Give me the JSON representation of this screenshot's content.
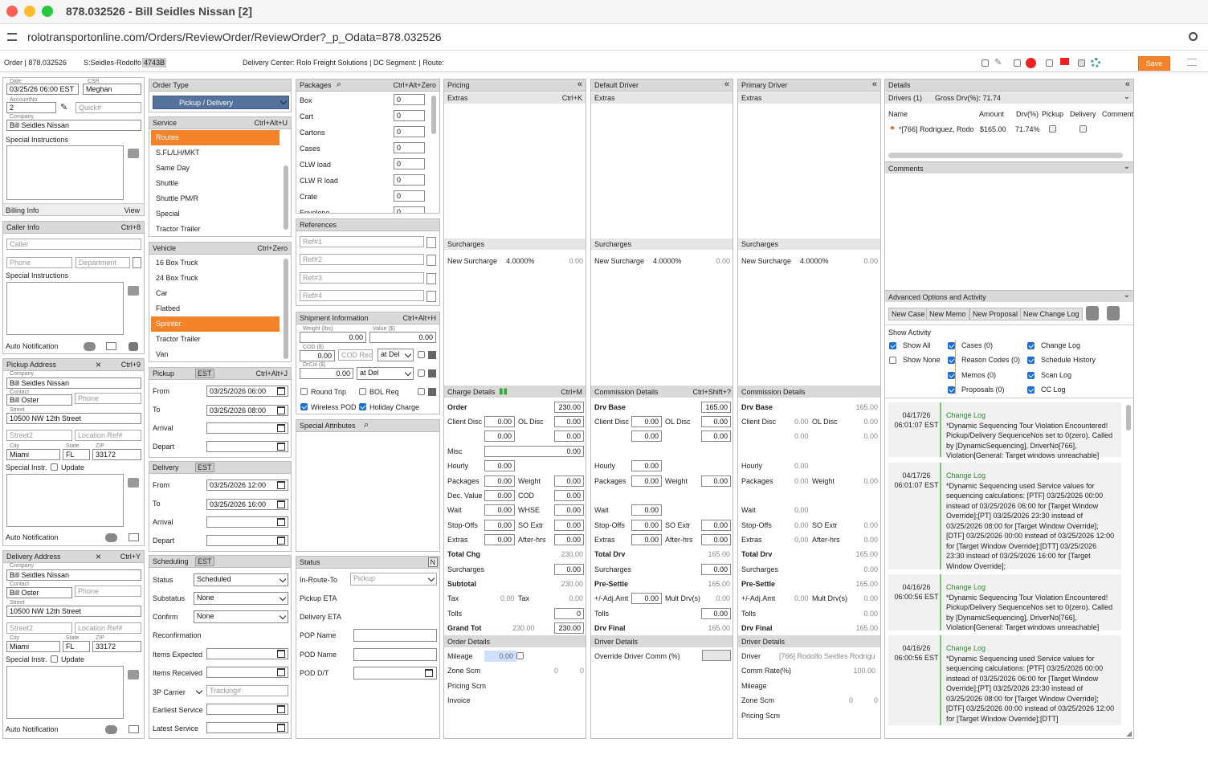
{
  "window": {
    "title": "878.032526 - Bill Seidles Nissan [2]",
    "url": "rolotransportonline.com/Orders/ReviewOrder/ReviewOrder?_p_Odata=878.032526"
  },
  "orderbar": {
    "order": "Order | 878.032526",
    "s": "S:Seidles-Rodolfo",
    "sbadge": "4743B",
    "dc": "Delivery Center: Rolo Freight Solutions | DC Segment: | Route:",
    "save": "Save"
  },
  "left": {
    "date_lbl": "Date",
    "date": "03/25/26 06:00 EST",
    "csr_lbl": "CSR",
    "csr": "Meghan",
    "acct_lbl": "AccountNo",
    "acct": "2",
    "quick": "Quick#",
    "company_lbl": "Company",
    "company": "Bill Seidles Nissan",
    "special": "Special Instructions",
    "billing": "Billing Info",
    "view": "View",
    "caller_h": "Caller Info",
    "caller_k": "Ctrl+8",
    "caller": "Caller",
    "phone": "Phone",
    "dept": "Department",
    "special2": "Special Instructions",
    "autonot": "Auto Notification",
    "pickup_h": "Pickup Address",
    "pickup_k": "Ctrl+9",
    "p_company": "Bill Seidles Nissan",
    "p_contact": "Bill Oster",
    "p_street": "10500 NW 12th Street",
    "street2": "Street2",
    "locref": "Location Ref#",
    "city_lbl": "City",
    "state_lbl": "State",
    "zip_lbl": "ZIP",
    "contact_lbl": "Contact",
    "street_lbl": "Street",
    "city": "Miami",
    "state": "FL",
    "zip": "33172",
    "special_instr": "Special Instr.",
    "update": "Update",
    "deliv_h": "Delivery Address",
    "deliv_k": "Ctrl+Y"
  },
  "col2": {
    "ordertype_h": "Order Type",
    "ordertype": "Pickup / Delivery",
    "service_h": "Service",
    "service_k": "Ctrl+Alt+U",
    "services": [
      "Routes",
      "S.FL/LH/MKT",
      "Same Day",
      "Shuttle",
      "Shuttle PM/R",
      "Special",
      "Tractor Trailer"
    ],
    "vehicle_h": "Vehicle",
    "vehicle_k": "Ctrl+Zero",
    "vehicles": [
      "16 Box Truck",
      "24 Box Truck",
      "Car",
      "Flatbed",
      "Sprinter",
      "Tractor Trailer",
      "Van"
    ],
    "pickup_h": "Pickup",
    "est": "EST",
    "pickup_k": "Ctrl+Alt+J",
    "from": "From",
    "to": "To",
    "arrival": "Arrival",
    "depart": "Depart",
    "p_from": "03/25/2026 06:00",
    "p_to": "03/25/2026 08:00",
    "delivery_h": "Delivery",
    "d_from": "03/25/2026 12:00",
    "d_to": "03/25/2026 16:00",
    "sched_h": "Scheduling",
    "status": "Status",
    "status_v": "Scheduled",
    "substatus": "Substatus",
    "substatus_v": "None",
    "confirm": "Confirm",
    "confirm_v": "None",
    "reconf": "Reconfirmation",
    "expected": "Items Expected",
    "received": "Items Received",
    "carrier": "3P Carrier",
    "tracking": "Tracking#",
    "earliest": "Earliest Service",
    "latest": "Latest Service"
  },
  "col3": {
    "packages_h": "Packages",
    "packages_k": "Ctrl+Alt+Zero",
    "packages": [
      "Box",
      "Cart",
      "Cartons",
      "Cases",
      "CLW load",
      "CLW R load",
      "Crate",
      "Envelope"
    ],
    "zero": "0",
    "refs_h": "References",
    "refs": [
      "Ref#1",
      "Ref#2",
      "Ref#3",
      "Ref#4"
    ],
    "ship_h": "Shipment Information",
    "ship_k": "Ctrl+Alt+H",
    "weight_lbl": "Weight (lbs)",
    "value_lbl": "Value ($)",
    "cod_lbl": "COD ($)",
    "codrec": "COD Rec",
    "drcol_lbl": "DrCol ($)",
    "atdel": "at Del",
    "v000": "0.00",
    "roundtrip": "Round Trip",
    "bolreq": "BOL Req",
    "wireless": "Wireless POD",
    "holiday": "Holiday Charge",
    "attrs_h": "Special Attributes",
    "status_h": "Status",
    "n": "N",
    "inroute": "In-Route-To",
    "pickup": "Pickup",
    "pickupeta": "Pickup ETA",
    "delivery_eta": "Delivery ETA",
    "popname": "POP Name",
    "podname": "POD Name",
    "poddt": "POD D/T"
  },
  "pricing": {
    "h": "Pricing",
    "extras": "Extras",
    "extras_k": "Ctrl+K",
    "surch": "Surcharges",
    "newsurch": "New Surcharge",
    "pct": "4.0000%",
    "v": "0.00",
    "cd_h": "Charge Details",
    "cd_k": "Ctrl+M",
    "order": "Order",
    "order_v": "230.00",
    "clientdisc": "Client Disc",
    "oldisc": "OL Disc",
    "misc": "Misc",
    "hourly": "Hourly",
    "packages": "Packages",
    "weight": "Weight",
    "decval": "Dec. Value",
    "cod": "COD",
    "wait": "Wait",
    "whse": "WHSE",
    "stopoffs": "Stop-Offs",
    "soextr": "SO Extr",
    "extras2": "Extras",
    "afterhrs": "After-hrs",
    "totalchg": "Total Chg",
    "totalchg_v": "230.00",
    "surcharges": "Surcharges",
    "subtotal": "Subtotal",
    "subtotal_v": "230.00",
    "tax": "Tax",
    "tolls": "Tolls",
    "tolls_v": "0",
    "grandtot": "Grand Tot",
    "grandtot_v": "230.00",
    "od_h": "Order Details",
    "mileage": "Mileage",
    "zonescm": "Zone Scm",
    "zero": "0",
    "pricingscm": "Pricing Scm",
    "invoice": "Invoice"
  },
  "defdrv": {
    "h": "Default Driver",
    "cm_h": "Commission Details",
    "cm_k": "Ctrl+Shift+?",
    "drvbase": "Drv Base",
    "drvbase_v": "165.00",
    "totaldrv": "Total Drv",
    "presettle": "Pre-Settle",
    "adjamt": "+/-Adj.Amt",
    "multdrv": "Mult Drv(s)",
    "drvfinal": "Drv Final",
    "dd_h": "Driver Details",
    "override": "Override Driver Comm (%)"
  },
  "primdrv": {
    "h": "Primary Driver",
    "driver": "Driver",
    "driver_v": "[766] Rodolfo Seidles Rodrigu",
    "commrate": "Comm Rate(%)",
    "commrate_v": "100.00",
    "mileage": "Mileage",
    "zonescm": "Zone Scm",
    "pricingscm": "Pricing Scm"
  },
  "details": {
    "h": "Details",
    "drivers": "Drivers (1)",
    "gross": "Gross Drv(%): 71.74",
    "cols": [
      "Name",
      "Amount",
      "Drv(%)",
      "Pickup",
      "Delivery",
      "Comment"
    ],
    "row": {
      "name": "*[766] Rodriguez, Rodo",
      "amount": "$165.00",
      "pct": "71.74%"
    },
    "comments_h": "Comments",
    "adv_h": "Advanced Options and Activity",
    "btns": [
      "New Case",
      "New Memo",
      "New Proposal",
      "New Change Log"
    ],
    "show": "Show Activity",
    "showall": "Show All",
    "shownone": "Show None",
    "acts": [
      "Cases (0)",
      "Reason Codes (0)",
      "Memos (0)",
      "Proposals (0)",
      "Change Log",
      "Schedule History",
      "Scan Log",
      "CC Log"
    ],
    "logs": [
      {
        "date": "04/17/26",
        "time": "06:01:07 EST",
        "head": "Change Log",
        "text": "*Dynamic Sequencing Tour Violation Encountered! Pickup/Delivery SequenceNos set to 0(zero). Called by [DynamicSequencing], DriverNo[766], Violation[General: Target windows unreachable]"
      },
      {
        "date": "04/17/26",
        "time": "06:01:07 EST",
        "head": "Change Log",
        "text": "*Dynamic Sequencing used Service values for sequencing calculations: [PTF] 03/25/2026 00:00 instead of 03/25/2026 06:00 for [Target Window Override];[PT] 03/25/2026 23:30 instead of 03/25/2026 08:00 for [Target Window Override];[DTF] 03/25/2026 00:00 instead of 03/25/2026 12:00 for [Target Window Override];[DTT] 03/25/2026 23:30 instead of 03/25/2026 16:00 for [Target Window Override];"
      },
      {
        "date": "04/16/26",
        "time": "06:00:56 EST",
        "head": "Change Log",
        "text": "*Dynamic Sequencing Tour Violation Encountered! Pickup/Delivery SequenceNos set to 0(zero). Called by [DynamicSequencing], DriverNo[766], Violation[General: Target windows unreachable]"
      },
      {
        "date": "04/16/26",
        "time": "06:00:56 EST",
        "head": "Change Log",
        "text": "*Dynamic Sequencing used Service values for sequencing calculations: [PTF] 03/25/2026 00:00 instead of 03/25/2026 06:00 for [Target Window Override];[PT] 03/25/2026 23:30 instead of 03/25/2026 08:00 for [Target Window Override];[DTF] 03/25/2026 00:00 instead of 03/25/2026 12:00 for [Target Window Override];[DTT]"
      }
    ]
  }
}
